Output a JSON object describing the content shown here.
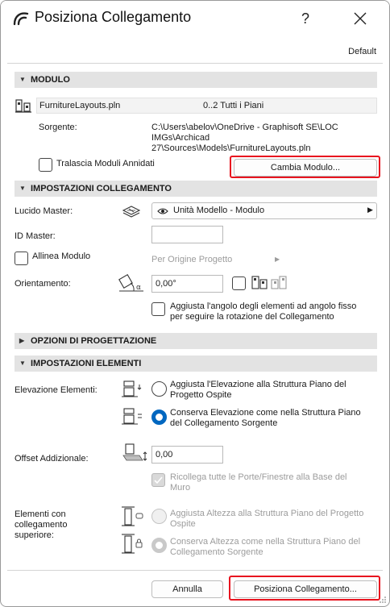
{
  "window": {
    "title": "Posiziona Collegamento",
    "help": "?",
    "preset": "Default"
  },
  "sections": {
    "modulo": "MODULO",
    "impostazioni_collegamento": "IMPOSTAZIONI COLLEGAMENTO",
    "opzioni_progettazione": "OPZIONI DI PROGETTAZIONE",
    "impostazioni_elementi": "IMPOSTAZIONI ELEMENTI"
  },
  "modulo": {
    "file_name": "FurnitureLayouts.pln",
    "stories": "0..2 Tutti i Piani",
    "source_label": "Sorgente:",
    "source_path_lines": [
      "C:\\Users\\abelov\\OneDrive - Graphisoft SE\\LOC",
      "IMGs\\Archicad",
      "27\\Sources\\Models\\FurnitureLayouts.pln"
    ],
    "skip_nested": "Tralascia Moduli Annidati",
    "change_module": "Cambia Modulo..."
  },
  "collegamento": {
    "lucido_label": "Lucido Master:",
    "lucido_value": "Unità Modello - Modulo",
    "id_label": "ID Master:",
    "id_value": "",
    "allinea_label": "Allinea Modulo",
    "allinea_value": "Per Origine Progetto",
    "orient_label": "Orientamento:",
    "orient_value": "0,00°",
    "adjust_angle_lines": [
      "Aggiusta l'angolo degli elementi ad angolo fisso",
      "per seguire la rotazione del Collegamento"
    ]
  },
  "elementi": {
    "elev_label": "Elevazione Elementi:",
    "elev_opt1_lines": [
      "Aggiusta l'Elevazione alla Struttura Piano del",
      "Progetto Ospite"
    ],
    "elev_opt2_lines": [
      "Conserva Elevazione come nella Struttura Piano",
      "del Collegamento Sorgente"
    ],
    "offset_label": "Offset Addizionale:",
    "offset_value": "0,00",
    "reconnect_lines": [
      "Ricollega tutte le Porte/Finestre alla Base del",
      "Muro"
    ],
    "upper_label_lines": [
      "Elementi con",
      "collegamento",
      "superiore:"
    ],
    "upper_opt1_lines": [
      "Aggiusta Altezza alla Struttura Piano del Progetto",
      "Ospite"
    ],
    "upper_opt2_lines": [
      "Conserva Altezza come nella Struttura Piano del",
      "Collegamento Sorgente"
    ]
  },
  "footer": {
    "cancel": "Annulla",
    "place": "Posiziona Collegamento..."
  },
  "colors": {
    "accent": "#0067c0",
    "highlight": "#e8141f",
    "header_bg": "#e3e3e3"
  }
}
